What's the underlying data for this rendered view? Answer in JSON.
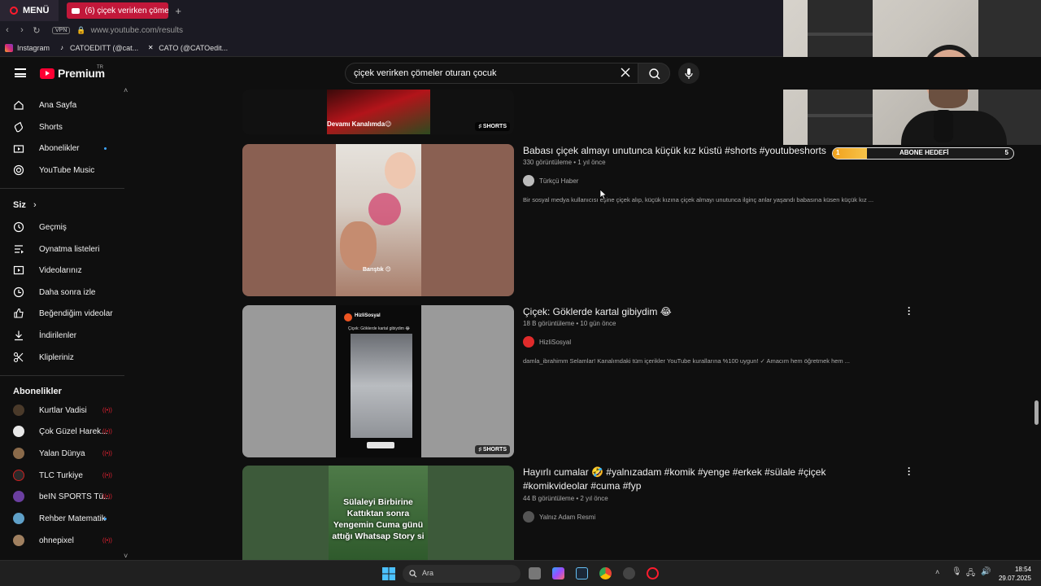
{
  "browser": {
    "menu_label": "MENÜ",
    "tab_title": "(6) çiçek verirken çömeler",
    "vpn_label": "VPN",
    "url": "www.youtube.com/results",
    "bookmarks": [
      "Instagram",
      "CATOEDITT (@cat...",
      "CATO (@CATOedit..."
    ]
  },
  "overlay": {
    "goal_label": "ABONE HEDEFİ",
    "goal_current": "1",
    "goal_target": "5",
    "goal_progress": 0.19
  },
  "youtube": {
    "logo_text": "Premium",
    "logo_region": "TR",
    "search_query": "çiçek verirken çömeler oturan çocuk"
  },
  "sidebar": {
    "main": [
      "Ana Sayfa",
      "Shorts",
      "Abonelikler",
      "YouTube Music"
    ],
    "you_heading": "Siz",
    "you": [
      "Geçmiş",
      "Oynatma listeleri",
      "Videolarınız",
      "Daha sonra izle",
      "Beğendiğim videolar",
      "İndirilenler",
      "Klipleriniz"
    ],
    "subs_heading": "Abonelikler",
    "subs": [
      "Kurtlar Vadisi",
      "Çok Güzel Harek...",
      "Yalan Dünya",
      "TLC Turkiye",
      "beIN SPORTS Tü...",
      "Rehber Matematik",
      "ohnepixel"
    ],
    "live_label": "((•))"
  },
  "results": [
    {
      "thumb_text": "Devamı Kanalımda😉",
      "badge": "SHORTS"
    },
    {
      "title": "Babası çiçek almayı unutunca küçük kız küstü #shorts #youtubeshorts",
      "meta": "330 görüntüleme • 1 yıl önce",
      "channel": "Türkçü Haber",
      "description": "Bir sosyal medya kullanıcısı eşine çiçek alıp, küçük kızına çiçek almayı unutunca ilginç anlar yaşandı babasına küsen küçük kız ...",
      "thumb_caption": "Barıştık 😊"
    },
    {
      "title": "Çiçek: Göklerde kartal gibiydim 😂",
      "meta": "18 B görüntüleme • 10 gün önce",
      "channel": "HizliSosyal",
      "description": "damla_ibrahimm Selamlar! Kanalımdaki tüm içerikler YouTube kurallarına %100 uygun! ✓ Amacım hem öğretmek hem ...",
      "thumb_header": "HizliSosyal",
      "thumb_sub": "Çiçek: Göklerde kartal gibiydim 😂",
      "badge": "SHORTS"
    },
    {
      "title": "Hayırlı cumalar 🤣 #yalnızadam #komik #yenge #erkek #sülale #çiçek #komikvideolar #cuma #fyp",
      "meta": "44 B görüntüleme • 2 yıl önce",
      "channel": "Yalnız Adam Resmi",
      "thumb_text": "Sülaleyi Birbirine Kattıktan sonra Yengemin Cuma günü attığı Whatsap Story si"
    }
  ],
  "taskbar": {
    "search_label": "Ara",
    "time": "18:54",
    "date": "29.07.2025"
  }
}
